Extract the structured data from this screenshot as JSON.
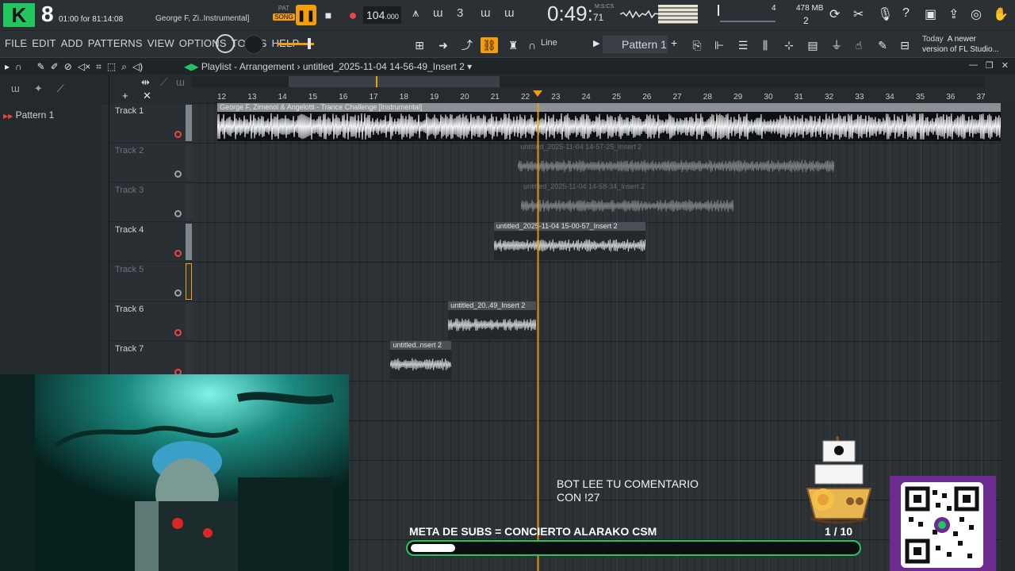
{
  "topbar": {
    "logo_letter": "K",
    "logo_number": "8",
    "timer": "01:00 for 81:14:08",
    "song_title": "George F, Zi..Instrumental]",
    "pat_label": "PAT",
    "song_label": "SONG",
    "tempo": "104",
    "tempo_decimal": ".000",
    "time_main": "0:49",
    "time_sub": "71",
    "time_format": "M:S:CS",
    "poly": "4",
    "mem": "478 MB",
    "mem_cores": "2"
  },
  "menubar": {
    "items": [
      "FILE",
      "EDIT",
      "ADD",
      "PATTERNS",
      "VIEW",
      "OPTIONS",
      "TOOLS",
      "HELP"
    ],
    "snap": "Line",
    "pattern": "Pattern 1",
    "news_date": "Today",
    "news_text_1": "A newer",
    "news_text_2": "version of FL Studio..."
  },
  "playlist": {
    "breadcrumb_1": "Playlist - Arrangement",
    "breadcrumb_2": "untitled_2025-11-04 14-56-49_Insert 2",
    "patterns": [
      "Pattern 1"
    ]
  },
  "tracks": [
    {
      "name": "Track 1",
      "active": true
    },
    {
      "name": "Track 2",
      "active": false
    },
    {
      "name": "Track 3",
      "active": false
    },
    {
      "name": "Track 4",
      "active": true
    },
    {
      "name": "Track 5",
      "active": false
    },
    {
      "name": "Track 6",
      "active": true
    },
    {
      "name": "Track 7",
      "active": true
    }
  ],
  "ruler": {
    "bars": [
      "12",
      "13",
      "14",
      "15",
      "16",
      "17",
      "18",
      "19",
      "20",
      "21",
      "22",
      "23",
      "24",
      "25",
      "26",
      "27",
      "28",
      "29",
      "30",
      "31",
      "32",
      "33",
      "34",
      "35",
      "36",
      "37"
    ],
    "playhead_bar": 22.45
  },
  "clips": [
    {
      "track": 1,
      "label": "George F, Zimenol & Angelotti - Trance Challenge [Instrumental]",
      "start_bar": 11.9,
      "end_bar": 38.2,
      "style": "big"
    },
    {
      "track": 2,
      "label": "untitled_2025-11-04 14-57-25_Insert 2",
      "start_bar": 21.8,
      "end_bar": 32.2,
      "style": "faded"
    },
    {
      "track": 3,
      "label": "untitled_2025-11-04 14-58-34_Insert 2",
      "start_bar": 21.9,
      "end_bar": 28.9,
      "style": "faded"
    },
    {
      "track": 4,
      "label": "untitled_2025-11-04 15-00-57_Insert 2",
      "start_bar": 21.0,
      "end_bar": 26.0,
      "style": "normal"
    },
    {
      "track": 6,
      "label": "untitled_20..49_Insert 2",
      "start_bar": 19.5,
      "end_bar": 22.4,
      "style": "normal"
    },
    {
      "track": 7,
      "label": "untitled..nsert 2",
      "start_bar": 17.6,
      "end_bar": 19.6,
      "style": "normal"
    }
  ],
  "overlay": {
    "bot_line_1": "BOT LEE TU COMENTARIO",
    "bot_line_2": "CON !27",
    "goal_label": "META DE SUBS = CONCIERTO ALARAKO CSM",
    "goal_current": "1",
    "goal_total": "10",
    "goal_count_text": "1  / 10",
    "goal_progress": 0.1
  },
  "colors": {
    "accent": "#f59e0b",
    "record": "#ef4444",
    "logo": "#22c55e",
    "goal_border": "#22c55e",
    "qr_bg": "#6b2b8f"
  }
}
